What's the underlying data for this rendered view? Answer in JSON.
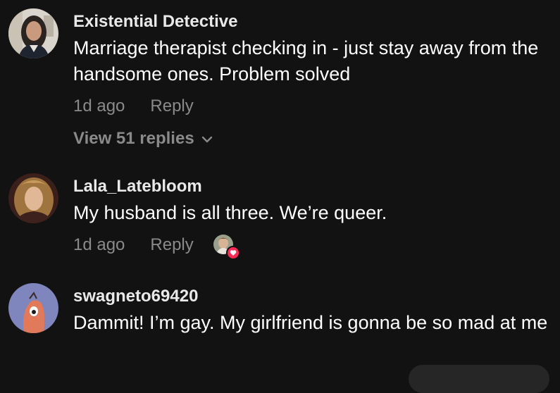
{
  "comments": [
    {
      "username": "Existential Detective",
      "text": "Marriage therapist checking in - just stay away from the handsome ones. Problem solved",
      "time": "1d ago",
      "reply_label": "Reply",
      "view_replies": "View 51 replies"
    },
    {
      "username": "Lala_Latebloom",
      "text": "My husband is all three. We’re queer.",
      "time": "1d ago",
      "reply_label": "Reply",
      "liked_by_creator": true
    },
    {
      "username": "swagneto69420",
      "text": "Dammit! I’m gay. My girlfriend is gonna be so mad at me"
    }
  ],
  "icons": {
    "chevron": "chevron-down-icon",
    "heart": "heart-icon"
  },
  "colors": {
    "background": "#121212",
    "meta_text": "#8a8a8a",
    "heart": "#fe2c55"
  }
}
